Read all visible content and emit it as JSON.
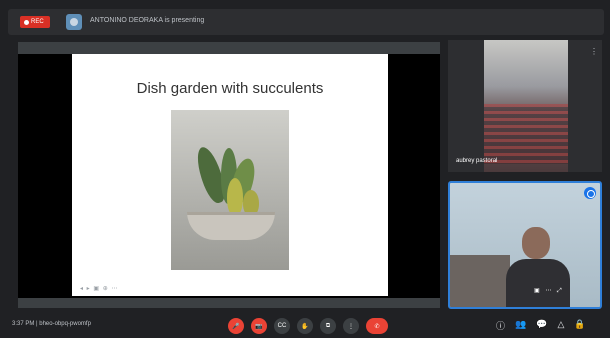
{
  "topbar": {
    "rec_label": "REC",
    "presenter_text": "ANTONINO DEORAKA is presenting"
  },
  "slide": {
    "title": "Dish garden with succulents",
    "nav": "◂ ▸ ▣ ⊕ ⋯"
  },
  "participants": [
    {
      "name": "aubrey pastoral"
    },
    {
      "name": ""
    }
  ],
  "tile1": {
    "menu_glyph": "⋮"
  },
  "tile2": {
    "controls_glyph": "▣ ⋯ ⤢"
  },
  "bottombar": {
    "time_and_code": "3:37 PM | bheo-obpq-pwomfp",
    "controls": [
      {
        "glyph": "🎤",
        "active": true
      },
      {
        "glyph": "📷",
        "active": true
      },
      {
        "glyph": "CC",
        "active": false
      },
      {
        "glyph": "✋",
        "active": false
      },
      {
        "glyph": "⧉",
        "active": false
      },
      {
        "glyph": "⋮",
        "active": false
      },
      {
        "glyph": "✆",
        "active": true
      }
    ],
    "right_icons": [
      "ⓘ",
      "👥",
      "💬",
      "△",
      "🔒"
    ]
  },
  "colors": {
    "background": "#202124",
    "accent": "#1a73e8",
    "danger": "#ea4335"
  }
}
